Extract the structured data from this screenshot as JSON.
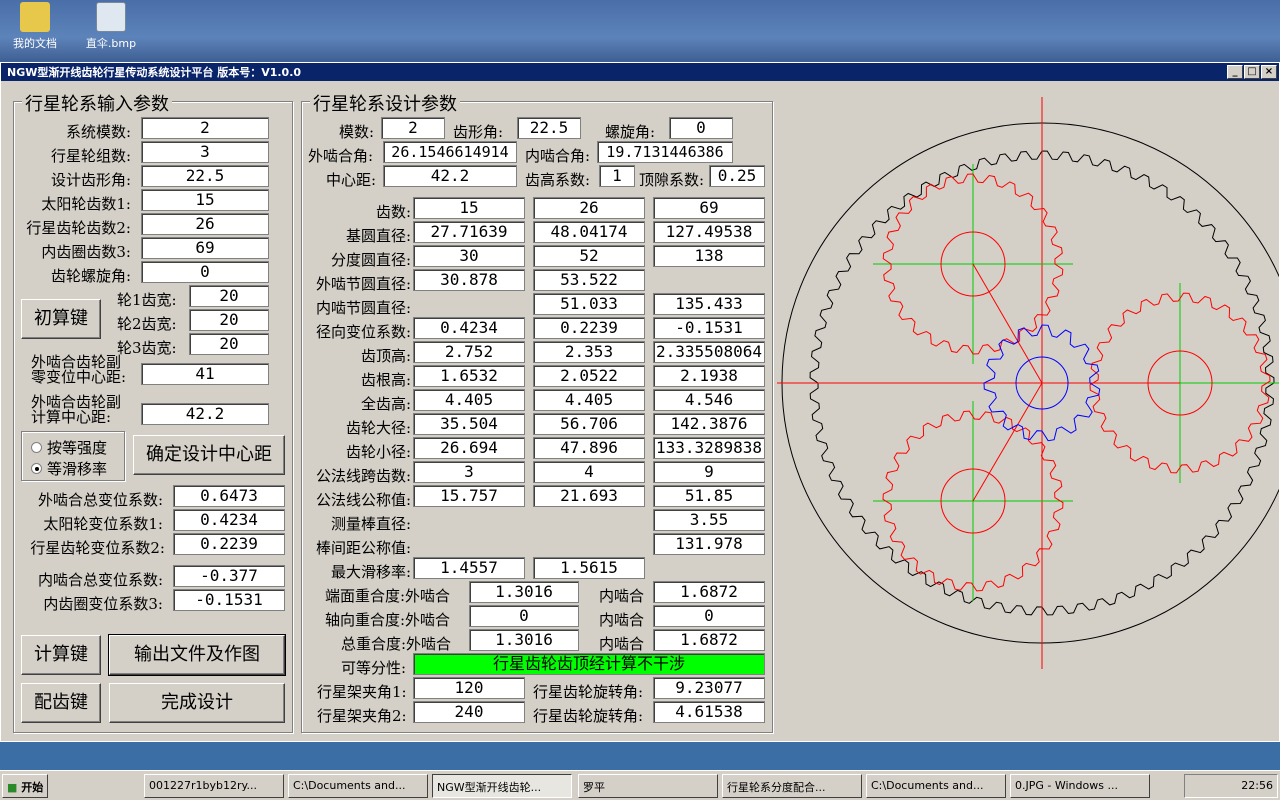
{
  "desktop": {
    "icons": [
      {
        "label": "我的文档"
      },
      {
        "label": "直伞.bmp"
      }
    ]
  },
  "window": {
    "title": "NGW型渐开线齿轮行星传动系统设计平台    版本号：V1.0.0",
    "min": "_",
    "max": "□",
    "close": "×"
  },
  "input": {
    "title": "行星轮系输入参数",
    "module_label": "系统模数:",
    "module": "2",
    "planets_label": "行星轮组数:",
    "planets": "3",
    "angle_label": "设计齿形角:",
    "angle": "22.5",
    "z1_label": "太阳轮齿数1:",
    "z1": "15",
    "z2_label": "行星齿轮齿数2:",
    "z2": "26",
    "z3_label": "内齿圈齿数3:",
    "z3": "69",
    "helix_label": "齿轮螺旋角:",
    "helix": "0",
    "init_btn": "初算键",
    "w1_label": "轮1齿宽:",
    "w1": "20",
    "w2_label": "轮2齿宽:",
    "w2": "20",
    "w3_label": "轮3齿宽:",
    "w3": "20",
    "zero_label1": "外啮合齿轮副",
    "zero_label2": "零变位中心距:",
    "zero_cd": "41",
    "calc_label1": "外啮合齿轮副",
    "calc_label2": "计算中心距:",
    "calc_cd": "42.2",
    "radio1": "按等强度",
    "radio2": "等滑移率",
    "confirm_btn": "确定设计中心距",
    "ext_total_label": "外啮合总变位系数:",
    "ext_total": "0.6473",
    "sun_shift_label": "太阳轮变位系数1:",
    "sun_shift": "0.4234",
    "planet_shift_label": "行星齿轮变位系数2:",
    "planet_shift": "0.2239",
    "int_total_label": "内啮合总变位系数:",
    "int_total": "-0.377",
    "ring_shift_label": "内齿圈变位系数3:",
    "ring_shift": "-0.1531",
    "calc_btn": "计算键",
    "output_btn": "输出文件及作图",
    "match_btn": "配齿键",
    "finish_btn": "完成设计"
  },
  "design": {
    "title": "行星轮系设计参数",
    "module_label": "模数:",
    "module": "2",
    "pa_label": "齿形角:",
    "pa": "22.5",
    "helix_label": "螺旋角:",
    "helix": "0",
    "ext_angle_label": "外啮合角:",
    "ext_angle": "26.1546614914",
    "int_angle_label": "内啮合角:",
    "int_angle": "19.7131446386",
    "cd_label": "中心距:",
    "cd": "42.2",
    "addendum_coef_label": "齿高系数:",
    "addendum_coef": "1",
    "clearance_label": "顶隙系数:",
    "clearance": "0.25",
    "rows": [
      {
        "label": "齿数:",
        "v": [
          "15",
          "26",
          "69"
        ]
      },
      {
        "label": "基圆直径:",
        "v": [
          "27.71639",
          "48.04174",
          "127.49538"
        ]
      },
      {
        "label": "分度圆直径:",
        "v": [
          "30",
          "52",
          "138"
        ]
      },
      {
        "label": "外啮节圆直径:",
        "v": [
          "30.878",
          "53.522",
          ""
        ]
      },
      {
        "label": "内啮节圆直径:",
        "v": [
          "",
          "51.033",
          "135.433"
        ]
      },
      {
        "label": "径向变位系数:",
        "v": [
          "0.4234",
          "0.2239",
          "-0.1531"
        ]
      },
      {
        "label": "齿顶高:",
        "v": [
          "2.752",
          "2.353",
          "2.335508064"
        ]
      },
      {
        "label": "齿根高:",
        "v": [
          "1.6532",
          "2.0522",
          "2.1938"
        ]
      },
      {
        "label": "全齿高:",
        "v": [
          "4.405",
          "4.405",
          "4.546"
        ]
      },
      {
        "label": "齿轮大径:",
        "v": [
          "35.504",
          "56.706",
          "142.3876"
        ]
      },
      {
        "label": "齿轮小径:",
        "v": [
          "26.694",
          "47.896",
          "133.3289838"
        ]
      },
      {
        "label": "公法线跨齿数:",
        "v": [
          "3",
          "4",
          "9"
        ]
      },
      {
        "label": "公法线公称值:",
        "v": [
          "15.757",
          "21.693",
          "51.85"
        ]
      },
      {
        "label": "测量棒直径:",
        "v": [
          "",
          "",
          "3.55"
        ]
      },
      {
        "label": "棒间距公称值:",
        "v": [
          "",
          "",
          "131.978"
        ]
      },
      {
        "label": "最大滑移率:",
        "v": [
          "1.4557",
          "1.5615",
          ""
        ]
      }
    ],
    "contact_face_label": "端面重合度:外啮合",
    "contact_face_ext": "1.3016",
    "contact_face_int_label": "内啮合",
    "contact_face_int": "1.6872",
    "contact_axial_label": "轴向重合度:外啮合",
    "contact_axial_ext": "0",
    "contact_axial_int_label": "内啮合",
    "contact_axial_int": "0",
    "contact_total_label": "总重合度:外啮合",
    "contact_total_ext": "1.3016",
    "contact_total_int_label": "内啮合",
    "contact_total_int": "1.6872",
    "divisible_label": "可等分性:",
    "divisible": "行星齿轮齿顶经计算不干涉",
    "divisible_color": "#00ff00",
    "carrier1_label": "行星架夹角1:",
    "carrier1": "120",
    "rot1_label": "行星齿轮旋转角:",
    "rot1": "9.23077",
    "carrier2_label": "行星架夹角2:",
    "carrier2": "240",
    "rot2_label": "行星齿轮旋转角:",
    "rot2": "4.61538"
  },
  "taskbar": {
    "start": "开始",
    "items": [
      "001227r1byb12ry...",
      "C:\\Documents and...",
      "NGW型渐开线齿轮...",
      "罗平",
      "行星轮系分度配合...",
      "C:\\Documents and...",
      "0.JPG - Windows ..."
    ],
    "clock": "22:56"
  }
}
